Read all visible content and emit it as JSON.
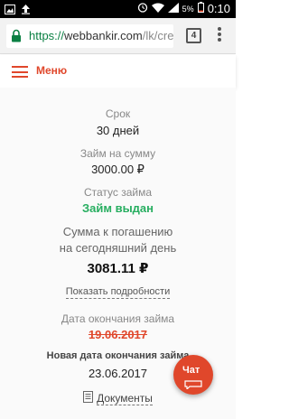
{
  "status_bar": {
    "icons_left": [
      "image-icon",
      "upload-icon"
    ],
    "battery": "5%",
    "time": "0:10"
  },
  "browser": {
    "url_scheme": "https://",
    "url_host": "webbankir.com",
    "url_path": "/lk/cre",
    "tab_count": "4"
  },
  "header": {
    "menu_label": "Меню",
    "accent": "#e0472b"
  },
  "loan": {
    "term_label": "Срок",
    "term_value": "30 дней",
    "amount_label": "Займ на сумму",
    "amount_value": "3000.00 ₽",
    "status_label": "Статус займа",
    "status_value": "Займ выдан",
    "status_color": "#27ae60",
    "repay_label_line1": "Сумма к погашению",
    "repay_label_line2": "на сегодняшний день",
    "repay_value": "3081.11 ₽",
    "details_link": "Показать подробности",
    "end_date_label": "Дата окончания займа",
    "end_date_old": "19.06.2017",
    "new_end_date_label": "Новая дата окончания займа",
    "new_end_date": "23.06.2017",
    "documents_link": "Документы"
  },
  "chat": {
    "label": "Чат"
  }
}
